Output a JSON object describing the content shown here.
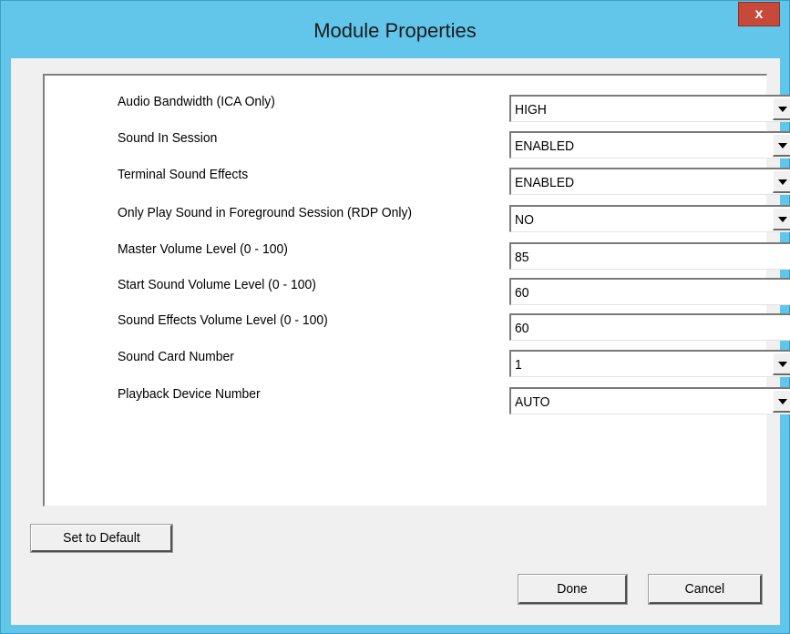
{
  "window": {
    "title": "Module Properties",
    "close_glyph": "x"
  },
  "settings": [
    {
      "label": "Audio Bandwidth (ICA Only)",
      "value": "HIGH",
      "control": "dropdown"
    },
    {
      "label": "Sound In Session",
      "value": "ENABLED",
      "control": "dropdown"
    },
    {
      "label": "Terminal Sound Effects",
      "value": "ENABLED",
      "control": "dropdown"
    },
    {
      "label": "Only Play Sound in Foreground Session (RDP Only)",
      "value": "NO",
      "control": "dropdown"
    },
    {
      "label": "Master Volume Level (0 - 100)",
      "value": "85",
      "control": "text"
    },
    {
      "label": "Start Sound Volume Level (0 - 100)",
      "value": "60",
      "control": "text"
    },
    {
      "label": "Sound Effects Volume Level (0 - 100)",
      "value": "60",
      "control": "text"
    },
    {
      "label": "Sound Card Number",
      "value": "1",
      "control": "dropdown"
    },
    {
      "label": "Playback Device Number",
      "value": "AUTO",
      "control": "dropdown"
    }
  ],
  "buttons": {
    "default": "Set to Default",
    "done": "Done",
    "cancel": "Cancel"
  },
  "colors": {
    "title_bar": "#61c6ea",
    "close_button": "#c7493a",
    "dialog_face": "#f0f0f0"
  }
}
